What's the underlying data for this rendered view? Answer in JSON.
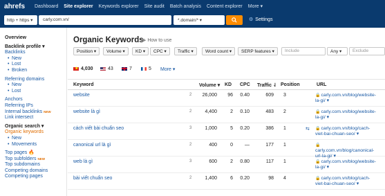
{
  "app": {
    "logo_a": "a",
    "logo_rest": "hrefs"
  },
  "nav": [
    "Dashboard",
    "Site explorer",
    "Keywords explorer",
    "Site audit",
    "Batch analysis",
    "Content explorer",
    "More ▾"
  ],
  "search": {
    "protocol": "http + https ▾",
    "domain": "carly.com.vn/",
    "mode": "*.domain/* ▾",
    "button_icon": "search-icon",
    "settings_label": "Settings"
  },
  "sidebar": {
    "overview": "Overview",
    "backlink_profile": "Backlink profile ▾",
    "backlinks": "Backlinks",
    "backlinks_new": "New",
    "backlinks_lost": "Lost",
    "backlinks_broken": "Broken",
    "referring_domains": "Referring domains",
    "rd_new": "New",
    "rd_lost": "Lost",
    "anchors": "Anchors",
    "referring_ips": "Referring IPs",
    "internal_backlinks": "Internal backlinks",
    "new_badge": "NEW",
    "link_intersect": "Link intersect",
    "organic_search": "Organic search ▾",
    "organic_keywords": "Organic keywords",
    "ok_new": "New",
    "ok_movements": "Movements",
    "top_pages": "Top pages",
    "top_subfolders": "Top subfolders",
    "top_subdomains": "Top subdomains",
    "competing_domains": "Competing domains",
    "competing_pages": "Competing pages"
  },
  "main": {
    "title": "Organic Keywords",
    "title_info": "ⁱ",
    "how_to": "How to use",
    "filters": [
      "Position ▾",
      "Volume ▾",
      "KD ▾",
      "CPC ▾",
      "Traffic ▾",
      "Word count ▾",
      "SERP features ▾"
    ],
    "include_placeholder": "Include",
    "any": "Any ▾",
    "exclude_placeholder": "Exclude",
    "countries": [
      {
        "code": "vn",
        "value": "4,030"
      },
      {
        "code": "us",
        "value": "43"
      },
      {
        "code": "gb",
        "value": "7"
      },
      {
        "code": "fr",
        "value": "5"
      }
    ],
    "more_countries": "More ▾"
  },
  "table": {
    "headers": [
      "Keyword",
      "Volume ▾",
      "KD",
      "CPC",
      "Traffic ⇃",
      "Position",
      "URL"
    ],
    "rows": [
      {
        "keyword": "website",
        "words": "2",
        "volume": "26,000",
        "kd": "96",
        "cpc": "0.40",
        "traffic": "609",
        "position": "3",
        "url": "carly.com.vn/blog/website-la-gi/ ▾",
        "sitelink": ""
      },
      {
        "keyword": "website là gì",
        "words": "2",
        "volume": "4,400",
        "kd": "2",
        "cpc": "0.10",
        "traffic": "483",
        "position": "2",
        "url": "carly.com.vn/blog/website-la-gi/ ▾",
        "sitelink": ""
      },
      {
        "keyword": "cách viết bài chuẩn seo",
        "words": "3",
        "volume": "1,000",
        "kd": "5",
        "cpc": "0.20",
        "traffic": "386",
        "position": "1",
        "url": "carly.com.vn/blog/cach-viet-bai-chuan-seo/ ▾",
        "sitelink": "⇆"
      },
      {
        "keyword": "canonical url là gì",
        "words": "2",
        "volume": "400",
        "kd": "0",
        "cpc": "—",
        "traffic": "177",
        "position": "1",
        "url": "carly.com.vn/blog/canonical-url-la-gi/ ▾",
        "sitelink": ""
      },
      {
        "keyword": "web là gì",
        "words": "3",
        "volume": "600",
        "kd": "2",
        "cpc": "0.80",
        "traffic": "117",
        "position": "1",
        "url": "carly.com.vn/blog/website-la-gi/ ▾",
        "sitelink": ""
      },
      {
        "keyword": "bài viết chuẩn seo",
        "words": "2",
        "volume": "1,400",
        "kd": "6",
        "cpc": "0.20",
        "traffic": "98",
        "position": "4",
        "url": "carly.com.vn/blog/cach-viet-bai-chuan-seo/ ▾",
        "sitelink": ""
      }
    ]
  },
  "colors": {
    "nav_bg": "#0a3a6e",
    "accent": "#ff8c00",
    "link": "#1a5aa5"
  }
}
